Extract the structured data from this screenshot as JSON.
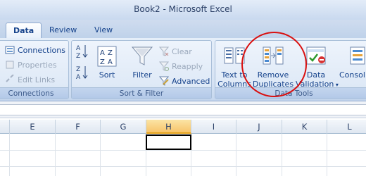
{
  "window": {
    "title": "Book2 - Microsoft Excel"
  },
  "tabs": [
    {
      "label": "Data",
      "active": true
    },
    {
      "label": "Review",
      "active": false
    },
    {
      "label": "View",
      "active": false
    }
  ],
  "groups": {
    "connections": {
      "label": "Connections",
      "buttons": {
        "connections": "Connections",
        "properties": "Properties",
        "edit_links": "Edit Links"
      }
    },
    "sort_filter": {
      "label": "Sort & Filter",
      "sort": "Sort",
      "filter": "Filter",
      "clear": "Clear",
      "reapply": "Reapply",
      "advanced": "Advanced"
    },
    "data_tools": {
      "label": "Data Tools",
      "text_to_columns": [
        "Text to",
        "Columns"
      ],
      "remove_duplicates": [
        "Remove",
        "Duplicates"
      ],
      "data_validation": [
        "Data",
        "Validation"
      ],
      "consolidate": "Consol"
    }
  },
  "columns": [
    "E",
    "F",
    "G",
    "H",
    "I",
    "J",
    "K",
    "L"
  ],
  "selected_column": "H",
  "colors": {
    "annotation": "#d90f0f",
    "selected_header": "#f7c46a"
  }
}
